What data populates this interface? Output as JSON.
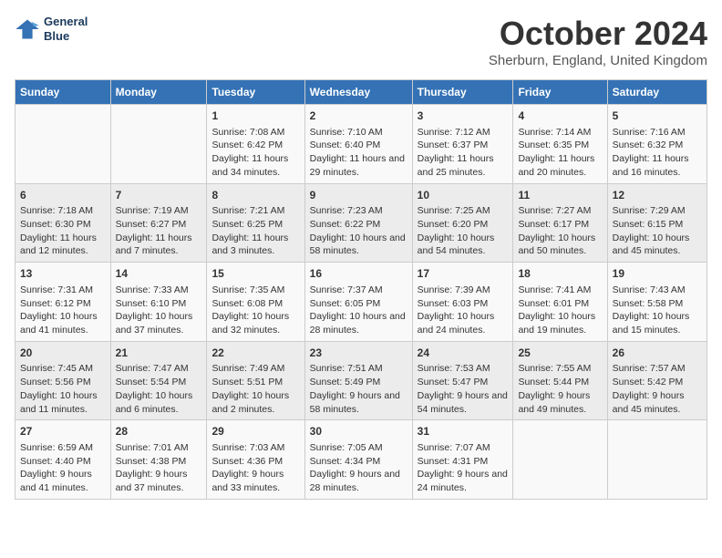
{
  "header": {
    "logo_line1": "General",
    "logo_line2": "Blue",
    "month": "October 2024",
    "location": "Sherburn, England, United Kingdom"
  },
  "days_of_week": [
    "Sunday",
    "Monday",
    "Tuesday",
    "Wednesday",
    "Thursday",
    "Friday",
    "Saturday"
  ],
  "weeks": [
    [
      {
        "day": "",
        "info": ""
      },
      {
        "day": "",
        "info": ""
      },
      {
        "day": "1",
        "info": "Sunrise: 7:08 AM\nSunset: 6:42 PM\nDaylight: 11 hours and 34 minutes."
      },
      {
        "day": "2",
        "info": "Sunrise: 7:10 AM\nSunset: 6:40 PM\nDaylight: 11 hours and 29 minutes."
      },
      {
        "day": "3",
        "info": "Sunrise: 7:12 AM\nSunset: 6:37 PM\nDaylight: 11 hours and 25 minutes."
      },
      {
        "day": "4",
        "info": "Sunrise: 7:14 AM\nSunset: 6:35 PM\nDaylight: 11 hours and 20 minutes."
      },
      {
        "day": "5",
        "info": "Sunrise: 7:16 AM\nSunset: 6:32 PM\nDaylight: 11 hours and 16 minutes."
      }
    ],
    [
      {
        "day": "6",
        "info": "Sunrise: 7:18 AM\nSunset: 6:30 PM\nDaylight: 11 hours and 12 minutes."
      },
      {
        "day": "7",
        "info": "Sunrise: 7:19 AM\nSunset: 6:27 PM\nDaylight: 11 hours and 7 minutes."
      },
      {
        "day": "8",
        "info": "Sunrise: 7:21 AM\nSunset: 6:25 PM\nDaylight: 11 hours and 3 minutes."
      },
      {
        "day": "9",
        "info": "Sunrise: 7:23 AM\nSunset: 6:22 PM\nDaylight: 10 hours and 58 minutes."
      },
      {
        "day": "10",
        "info": "Sunrise: 7:25 AM\nSunset: 6:20 PM\nDaylight: 10 hours and 54 minutes."
      },
      {
        "day": "11",
        "info": "Sunrise: 7:27 AM\nSunset: 6:17 PM\nDaylight: 10 hours and 50 minutes."
      },
      {
        "day": "12",
        "info": "Sunrise: 7:29 AM\nSunset: 6:15 PM\nDaylight: 10 hours and 45 minutes."
      }
    ],
    [
      {
        "day": "13",
        "info": "Sunrise: 7:31 AM\nSunset: 6:12 PM\nDaylight: 10 hours and 41 minutes."
      },
      {
        "day": "14",
        "info": "Sunrise: 7:33 AM\nSunset: 6:10 PM\nDaylight: 10 hours and 37 minutes."
      },
      {
        "day": "15",
        "info": "Sunrise: 7:35 AM\nSunset: 6:08 PM\nDaylight: 10 hours and 32 minutes."
      },
      {
        "day": "16",
        "info": "Sunrise: 7:37 AM\nSunset: 6:05 PM\nDaylight: 10 hours and 28 minutes."
      },
      {
        "day": "17",
        "info": "Sunrise: 7:39 AM\nSunset: 6:03 PM\nDaylight: 10 hours and 24 minutes."
      },
      {
        "day": "18",
        "info": "Sunrise: 7:41 AM\nSunset: 6:01 PM\nDaylight: 10 hours and 19 minutes."
      },
      {
        "day": "19",
        "info": "Sunrise: 7:43 AM\nSunset: 5:58 PM\nDaylight: 10 hours and 15 minutes."
      }
    ],
    [
      {
        "day": "20",
        "info": "Sunrise: 7:45 AM\nSunset: 5:56 PM\nDaylight: 10 hours and 11 minutes."
      },
      {
        "day": "21",
        "info": "Sunrise: 7:47 AM\nSunset: 5:54 PM\nDaylight: 10 hours and 6 minutes."
      },
      {
        "day": "22",
        "info": "Sunrise: 7:49 AM\nSunset: 5:51 PM\nDaylight: 10 hours and 2 minutes."
      },
      {
        "day": "23",
        "info": "Sunrise: 7:51 AM\nSunset: 5:49 PM\nDaylight: 9 hours and 58 minutes."
      },
      {
        "day": "24",
        "info": "Sunrise: 7:53 AM\nSunset: 5:47 PM\nDaylight: 9 hours and 54 minutes."
      },
      {
        "day": "25",
        "info": "Sunrise: 7:55 AM\nSunset: 5:44 PM\nDaylight: 9 hours and 49 minutes."
      },
      {
        "day": "26",
        "info": "Sunrise: 7:57 AM\nSunset: 5:42 PM\nDaylight: 9 hours and 45 minutes."
      }
    ],
    [
      {
        "day": "27",
        "info": "Sunrise: 6:59 AM\nSunset: 4:40 PM\nDaylight: 9 hours and 41 minutes."
      },
      {
        "day": "28",
        "info": "Sunrise: 7:01 AM\nSunset: 4:38 PM\nDaylight: 9 hours and 37 minutes."
      },
      {
        "day": "29",
        "info": "Sunrise: 7:03 AM\nSunset: 4:36 PM\nDaylight: 9 hours and 33 minutes."
      },
      {
        "day": "30",
        "info": "Sunrise: 7:05 AM\nSunset: 4:34 PM\nDaylight: 9 hours and 28 minutes."
      },
      {
        "day": "31",
        "info": "Sunrise: 7:07 AM\nSunset: 4:31 PM\nDaylight: 9 hours and 24 minutes."
      },
      {
        "day": "",
        "info": ""
      },
      {
        "day": "",
        "info": ""
      }
    ]
  ]
}
